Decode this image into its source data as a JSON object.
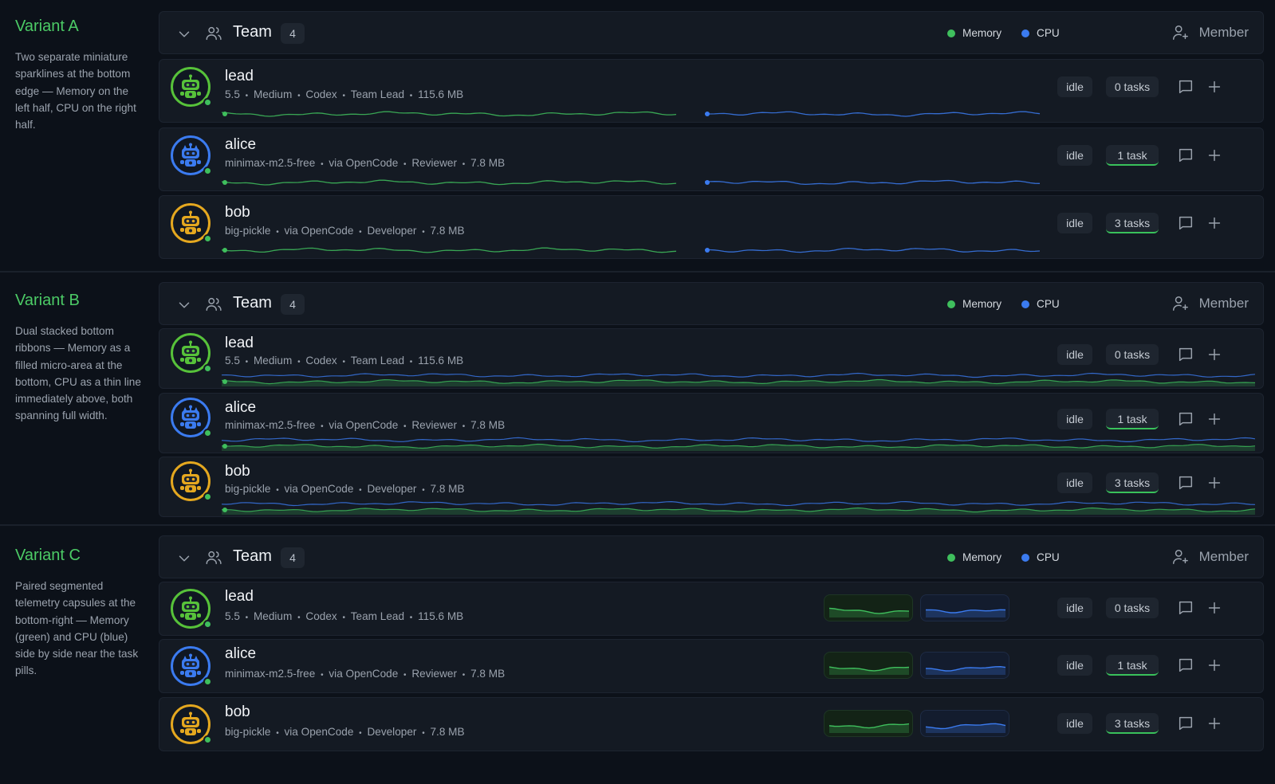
{
  "variants": [
    {
      "id": "a",
      "title": "Variant A",
      "description": "Two separate miniature sparklines at the bottom edge — Memory on the left half, CPU on the right half."
    },
    {
      "id": "b",
      "title": "Variant B",
      "description": "Dual stacked bottom ribbons — Memory as a filled micro-area at the bottom, CPU as a thin line immediately above, both spanning full width."
    },
    {
      "id": "c",
      "title": "Variant C",
      "description": "Paired segmented telemetry capsules at the bottom-right — Memory (green) and CPU (blue) side by side near the task pills."
    }
  ],
  "team": {
    "name": "Team",
    "count": "4",
    "member_label": "Member"
  },
  "legend": {
    "memory": "Memory",
    "cpu": "CPU",
    "memory_color": "#3fbf5d",
    "cpu_color": "#3b7bf0"
  },
  "members": [
    {
      "name": "lead",
      "model": "5.5",
      "tier": "Medium",
      "provider": "Codex",
      "role": "Team Lead",
      "memory": "115.6 MB",
      "status": "idle",
      "tasks": "0 tasks",
      "tasks_active": false,
      "ring_color": "#57c23a",
      "icon": "robot-icon"
    },
    {
      "name": "alice",
      "model": "minimax-m2.5-free",
      "tier": "",
      "provider": "via OpenCode",
      "role": "Reviewer",
      "memory": "7.8 MB",
      "status": "idle",
      "tasks": "1 task",
      "tasks_active": true,
      "ring_color": "#3b7bf0",
      "icon": "cat-bot-icon"
    },
    {
      "name": "bob",
      "model": "big-pickle",
      "tier": "",
      "provider": "via OpenCode",
      "role": "Developer",
      "memory": "7.8 MB",
      "status": "idle",
      "tasks": "3 tasks",
      "tasks_active": true,
      "ring_color": "#e5a81f",
      "icon": "bot-icon"
    }
  ]
}
